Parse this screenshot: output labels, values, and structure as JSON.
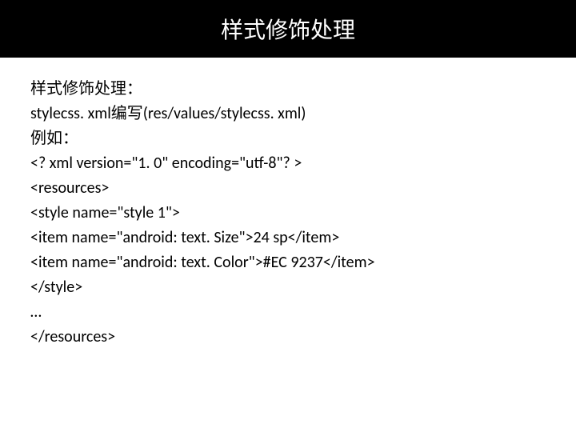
{
  "title": "样式修饰处理",
  "lines": [
    "样式修饰处理：",
    "stylecss. xml编写(res/values/stylecss. xml)",
    "例如：",
    "<? xml version=\"1. 0\" encoding=\"utf-8\"? >",
    "<resources>",
    "<style name=\"style 1\">",
    "<item name=\"android: text. Size\">24 sp</item>",
    "<item name=\"android: text. Color\">#EC 9237</item>",
    "</style>",
    "…",
    "</resources>"
  ]
}
